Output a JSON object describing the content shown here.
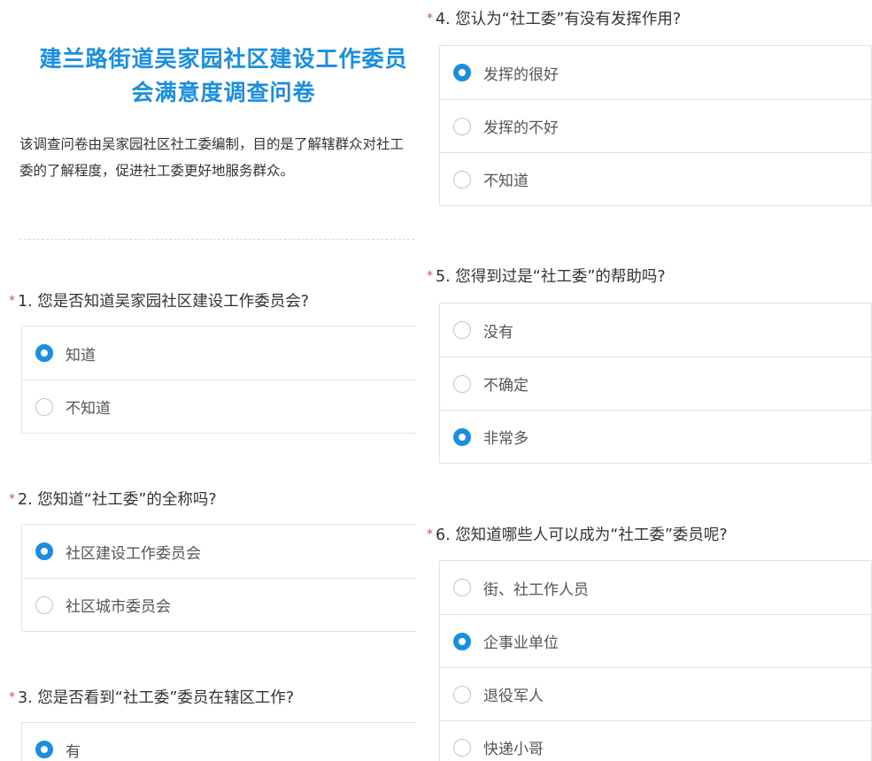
{
  "survey": {
    "title_line1": "建兰路街道吴家园社区建设工作委员",
    "title_line2": "会满意度调查问卷",
    "description": "该调查问卷由吴家园社区社工委编制，目的是了解辖群众对社工委的了解程度，促进社工委更好地服务群众。"
  },
  "questions": [
    {
      "required_mark": "*",
      "text": "1. 您是否知道吴家园社区建设工作委员会?",
      "options": [
        {
          "label": "知道",
          "selected": true
        },
        {
          "label": "不知道",
          "selected": false
        }
      ]
    },
    {
      "required_mark": "*",
      "text": "2. 您知道“社工委”的全称吗?",
      "options": [
        {
          "label": "社区建设工作委员会",
          "selected": true
        },
        {
          "label": "社区城市委员会",
          "selected": false
        }
      ]
    },
    {
      "required_mark": "*",
      "text": "3. 您是否看到“社工委”委员在辖区工作?",
      "options": [
        {
          "label": "有",
          "selected": true
        }
      ]
    },
    {
      "required_mark": "*",
      "text": "4. 您认为“社工委”有没有发挥作用?",
      "options": [
        {
          "label": "发挥的很好",
          "selected": true
        },
        {
          "label": "发挥的不好",
          "selected": false
        },
        {
          "label": "不知道",
          "selected": false
        }
      ]
    },
    {
      "required_mark": "*",
      "text": "5. 您得到过是“社工委”的帮助吗?",
      "options": [
        {
          "label": "没有",
          "selected": false
        },
        {
          "label": "不确定",
          "selected": false
        },
        {
          "label": "非常多",
          "selected": true
        }
      ]
    },
    {
      "required_mark": "*",
      "text": "6. 您知道哪些人可以成为“社工委”委员呢?",
      "options": [
        {
          "label": "街、社工作人员",
          "selected": false
        },
        {
          "label": "企事业单位",
          "selected": true
        },
        {
          "label": "退役军人",
          "selected": false
        },
        {
          "label": "快递小哥",
          "selected": false
        }
      ]
    }
  ],
  "colors": {
    "accent": "#1a8fe0",
    "required": "#e64a4a"
  }
}
